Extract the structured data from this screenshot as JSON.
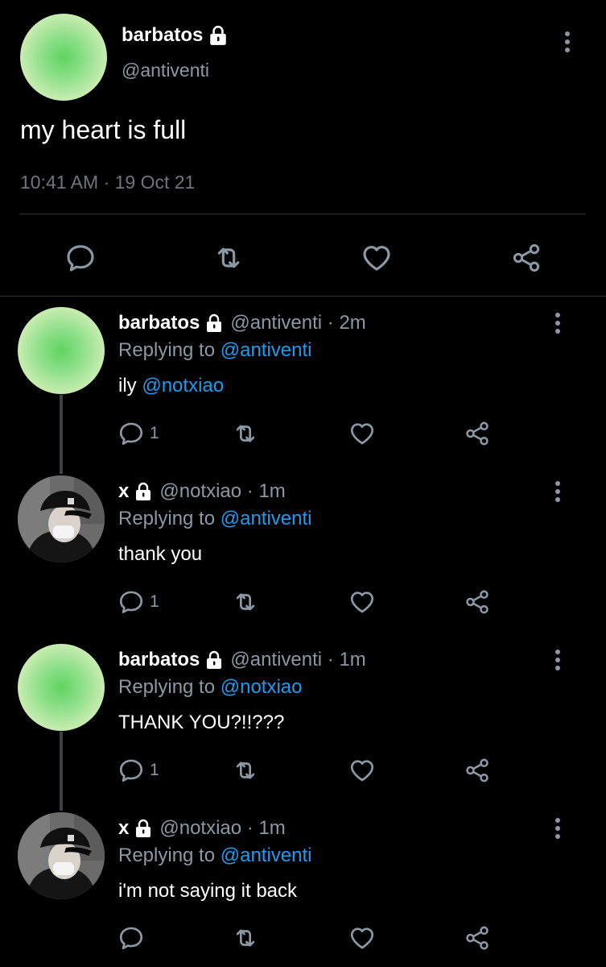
{
  "main_tweet": {
    "name": "barbatos",
    "handle": "@antiventi",
    "text": "my heart is full",
    "timestamp": "10:41 AM · 19 Oct 21",
    "locked": true,
    "avatar": "green-gradient-avatar",
    "actions": [
      "reply-icon",
      "retweet-icon",
      "like-icon",
      "share-icon"
    ]
  },
  "replies": [
    {
      "name": "barbatos",
      "handle": "@antiventi",
      "time": "2m",
      "replying_prefix": "Replying to ",
      "replying_to": "@antiventi",
      "text_prefix": "ily ",
      "text_mention": "@notxiao",
      "reply_count": "1",
      "avatar": "green-gradient-avatar"
    },
    {
      "name": "x",
      "handle": "@notxiao",
      "time": "1m",
      "replying_prefix": "Replying to ",
      "replying_to": "@antiventi",
      "text_prefix": "thank you",
      "text_mention": "",
      "reply_count": "1",
      "avatar": "photo-avatar"
    },
    {
      "name": "barbatos",
      "handle": "@antiventi",
      "time": "1m",
      "replying_prefix": "Replying to ",
      "replying_to": "@notxiao",
      "text_prefix": "THANK YOU?!!???",
      "text_mention": "",
      "reply_count": "1",
      "avatar": "green-gradient-avatar"
    },
    {
      "name": "x",
      "handle": "@notxiao",
      "time": "1m",
      "replying_prefix": "Replying to ",
      "replying_to": "@antiventi",
      "text_prefix": "i'm not saying it back",
      "text_mention": "",
      "reply_count": "",
      "avatar": "photo-avatar"
    }
  ],
  "colors": {
    "background": "#000000",
    "link": "#1d9bf0",
    "muted": "#8b98a5",
    "divider": "#2f3336"
  }
}
